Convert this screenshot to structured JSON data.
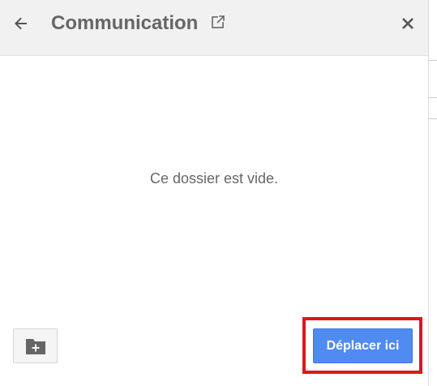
{
  "dialog": {
    "title": "Communication",
    "empty_message": "Ce dossier est vide.",
    "move_button_label": "Déplacer ici",
    "icons": {
      "back": "arrow-left-icon",
      "open_external": "open-in-new-icon",
      "close": "close-icon",
      "new_folder": "folder-plus-icon"
    },
    "colors": {
      "header_bg": "#f1f1f1",
      "primary_button": "#4f8bf0",
      "highlight": "#e0141e",
      "text": "#666666"
    }
  }
}
